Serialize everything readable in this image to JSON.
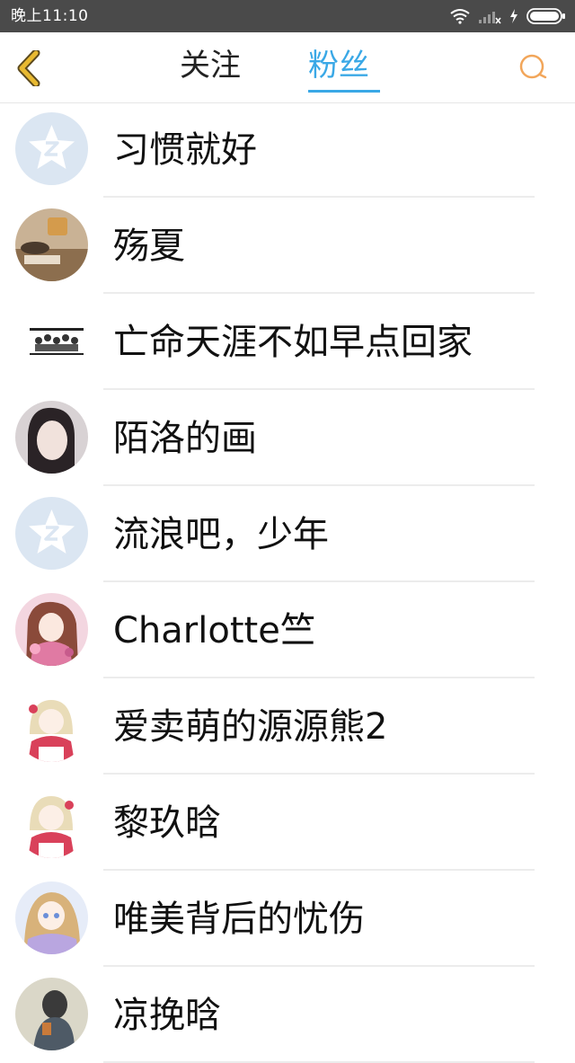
{
  "status_bar": {
    "time": "晚上11:10"
  },
  "nav": {
    "tabs": [
      {
        "label": "关注",
        "active": false
      },
      {
        "label": "粉丝",
        "active": true
      }
    ],
    "accent_color": "#3aa8e6",
    "back_icon_color": "#e8b931",
    "search_icon_color": "#f2a65a"
  },
  "fans": [
    {
      "name": "习惯就好",
      "avatar": "default-qzone-avatar"
    },
    {
      "name": "殇夏",
      "avatar": "photo-avatar"
    },
    {
      "name": "亡命天涯不如早点回家",
      "avatar": "group-photo-avatar"
    },
    {
      "name": "陌洛的画",
      "avatar": "portrait-avatar"
    },
    {
      "name": "流浪吧，少年",
      "avatar": "default-qzone-avatar"
    },
    {
      "name": "Charlotte竺",
      "avatar": "anime-avatar"
    },
    {
      "name": "爱卖萌的源源熊2",
      "avatar": "anime-avatar"
    },
    {
      "name": "黎玖晗",
      "avatar": "anime-avatar"
    },
    {
      "name": "唯美背后的忧伤",
      "avatar": "anime-avatar"
    },
    {
      "name": "凉挽晗",
      "avatar": "photo-avatar"
    }
  ]
}
